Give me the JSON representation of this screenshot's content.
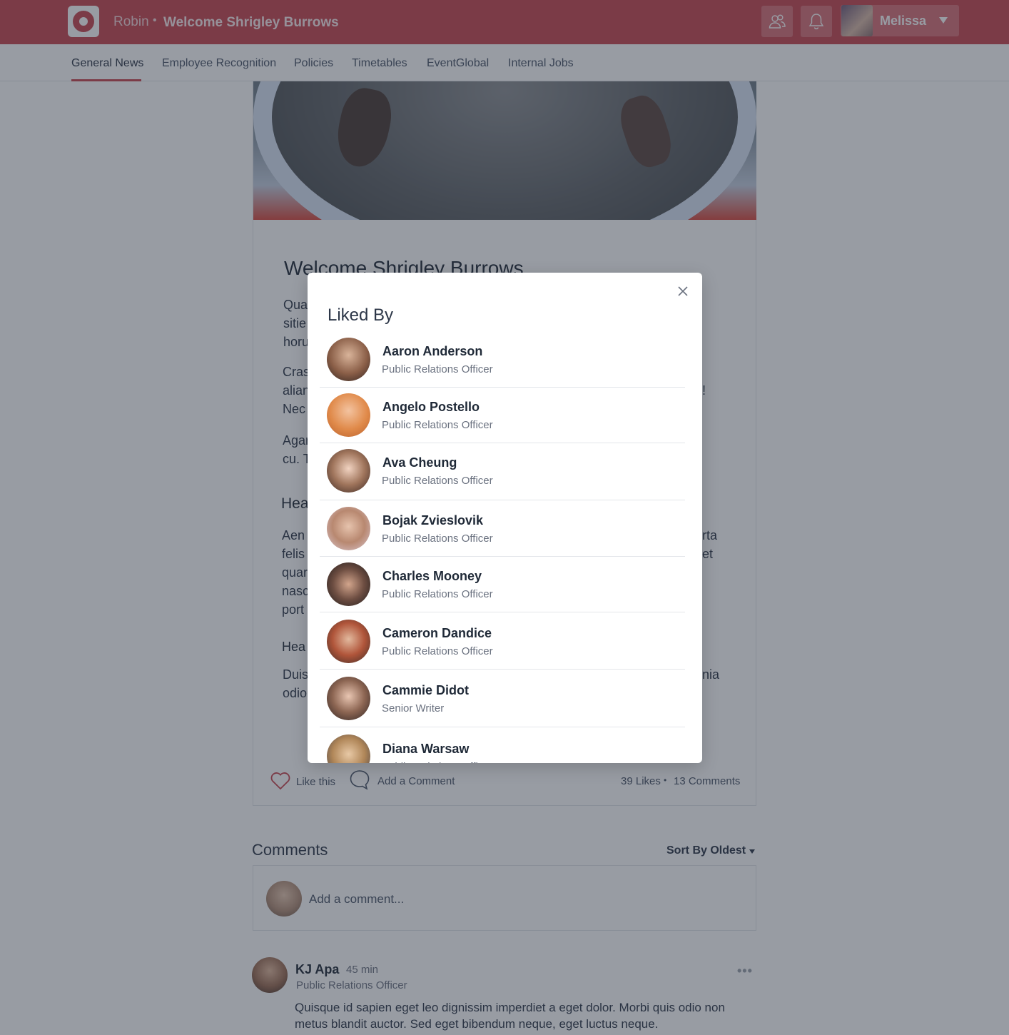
{
  "header": {
    "brand": "Robin",
    "separator": "•",
    "page_title": "Welcome Shrigley Burrows",
    "user_name": "Melissa",
    "accent_color": "#c8454f"
  },
  "nav": {
    "items": [
      "General News",
      "Employee Recognition",
      "Policies",
      "Timetables",
      "EventGlobal",
      "Internal Jobs"
    ],
    "active": "General News"
  },
  "article": {
    "title": "Welcome Shrigley Burrows",
    "para1": [
      "Qua",
      "sitie",
      "horu"
    ],
    "para2": [
      "Cras",
      "alian",
      "Nec"
    ],
    "para2_right": "!",
    "para3": [
      "Agar",
      "cu. T"
    ],
    "heading1": "Hea",
    "para4": [
      "Aen",
      "felis",
      "quar",
      "nasc",
      "port"
    ],
    "para4_right": [
      "rta",
      "et"
    ],
    "heading2": "Hea",
    "para5": [
      "Duis",
      "odio"
    ],
    "para5_right": "nia",
    "like_label": "Like this",
    "comment_label": "Add a Comment",
    "likes_count": "39 Likes",
    "stat_separator": "•",
    "comments_count": "13 Comments"
  },
  "comments": {
    "title": "Comments",
    "sort_label": "Sort By Oldest",
    "input_placeholder": "Add a comment...",
    "items": [
      {
        "name": "KJ Apa",
        "time": "45 min",
        "role": "Public Relations Officer",
        "text": "Quisque id sapien eget leo dignissim imperdiet a eget dolor. Morbi quis odio non metus blandit auctor. Sed eget bibendum neque, eget luctus neque.",
        "more": "•••"
      }
    ]
  },
  "modal": {
    "title": "Liked By",
    "likers": [
      {
        "name": "Aaron Anderson",
        "role": "Public Relations Officer"
      },
      {
        "name": "Angelo Postello",
        "role": "Public Relations Officer"
      },
      {
        "name": "Ava Cheung",
        "role": "Public Relations Officer"
      },
      {
        "name": "Bojak Zvieslovik",
        "role": "Public Relations Officer"
      },
      {
        "name": "Charles Mooney",
        "role": "Public Relations Officer"
      },
      {
        "name": "Cameron Dandice",
        "role": "Public Relations Officer"
      },
      {
        "name": "Cammie Didot",
        "role": "Senior Writer"
      },
      {
        "name": "Diana Warsaw",
        "role": "Public Relations Officer"
      }
    ]
  }
}
